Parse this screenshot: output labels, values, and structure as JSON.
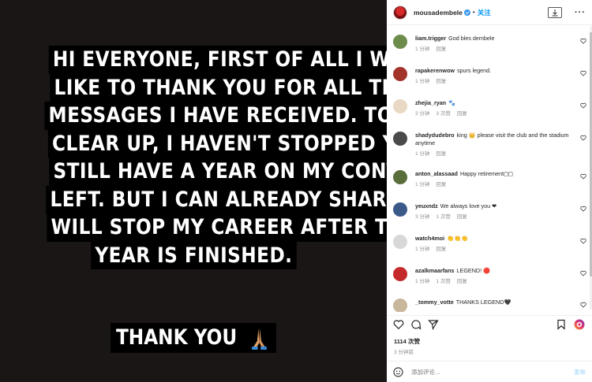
{
  "story": {
    "lines": [
      "HI EVERYONE, FIRST OF ALL I WOULD",
      "LIKE TO THANK YOU FOR ALL THE NICE",
      "MESSAGES I HAVE RECEIVED. TO",
      "CLEAR UP, I HAVEN'T STOPPED YET. I",
      "STILL HAVE A YEAR ON MY CONTRACT",
      "LEFT. BUT I CAN ALREADY SHARE I",
      "WILL STOP MY CAREER AFTER THIS",
      "YEAR IS FINISHED."
    ],
    "thanks": "THANK YOU"
  },
  "header": {
    "username": "mousadembele",
    "separator": "•",
    "follow_label": "关注",
    "more": "···"
  },
  "comments": [
    {
      "user": "liam.trigger",
      "text": "God bles dembele",
      "time": "1 分钟",
      "likes": "",
      "reply": "回复",
      "avatar_color": "#6d8b4a"
    },
    {
      "user": "rapakerenwow",
      "text": "spurs legend.",
      "time": "1 分钟",
      "likes": "",
      "reply": "回复",
      "avatar_color": "#a3322a"
    },
    {
      "user": "zhejia_ryan",
      "text": "🐾",
      "time": "3 分钟",
      "likes": "3 次赞",
      "reply": "回复",
      "avatar_color": "#e8d8c4"
    },
    {
      "user": "shadydudebro",
      "text": "king 👑 please visit the club and the stadium anytime",
      "time": "1 分钟",
      "likes": "",
      "reply": "回复",
      "avatar_color": "#4a4a4a"
    },
    {
      "user": "anton_alassaad",
      "text": "Happy retirement◻◻",
      "time": "1 分钟",
      "likes": "",
      "reply": "回复",
      "avatar_color": "#5a6e3c"
    },
    {
      "user": "yeuxndz",
      "text": "We always love you ❤",
      "time": "3 分钟",
      "likes": "1 次赞",
      "reply": "回复",
      "avatar_color": "#3b5a8a"
    },
    {
      "user": "watch4moi",
      "text": "👏👏👏",
      "time": "1 分钟",
      "likes": "",
      "reply": "回复",
      "avatar_color": "#d8d8d8"
    },
    {
      "user": "azalkmaarfans",
      "text": "LEGEND! 🔴",
      "time": "1 分钟",
      "likes": "1 次赞",
      "reply": "回复",
      "avatar_color": "#c42a2a"
    },
    {
      "user": "_tommy_votte",
      "text": "THANKS LEGEND🖤",
      "time": "",
      "likes": "",
      "reply": "",
      "avatar_color": "#c9b79c"
    }
  ],
  "likes_label": "1114 次赞",
  "time_label": "3 分钟前",
  "add_comment": {
    "placeholder": "添加评论...",
    "post_label": "发布"
  },
  "colors": {
    "accent": "#0095f6",
    "media_bg": "#1a1616",
    "heart": "#ed4956"
  }
}
